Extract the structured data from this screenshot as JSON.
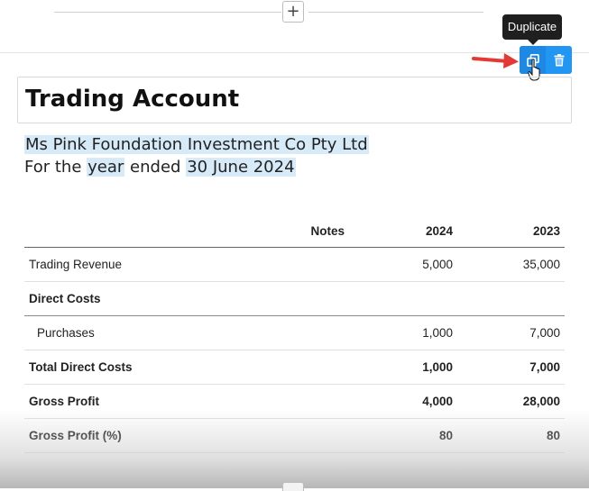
{
  "insert": {
    "plus_label": "+"
  },
  "toolbar": {
    "tooltip": "Duplicate",
    "buttons": [
      {
        "name": "duplicate",
        "icon": "duplicate-icon"
      },
      {
        "name": "delete",
        "icon": "trash-icon"
      }
    ],
    "color": "#2196f3"
  },
  "title": "Trading Account",
  "subtitle": {
    "company": "Ms Pink Foundation Investment Co Pty Ltd",
    "prefix": "For the",
    "period_type": "year",
    "mid": "ended",
    "date": "30 June 2024"
  },
  "table": {
    "headers": {
      "label": "",
      "notes": "Notes",
      "y1": "2024",
      "y2": "2023"
    },
    "rows": [
      {
        "label": "Trading Revenue",
        "notes": "",
        "y1": "5,000",
        "y2": "35,000"
      },
      {
        "label": "Direct Costs",
        "notes": "",
        "y1": "",
        "y2": ""
      },
      {
        "label": "Purchases",
        "notes": "",
        "y1": "1,000",
        "y2": "7,000"
      },
      {
        "label": "Total Direct Costs",
        "notes": "",
        "y1": "1,000",
        "y2": "7,000"
      },
      {
        "label": "Gross Profit",
        "notes": "",
        "y1": "4,000",
        "y2": "28,000"
      },
      {
        "label": "Gross Profit (%)",
        "notes": "",
        "y1": "80",
        "y2": "80"
      }
    ]
  },
  "colors": {
    "highlight": "#d6eaf8",
    "arrow": "#e53935"
  }
}
